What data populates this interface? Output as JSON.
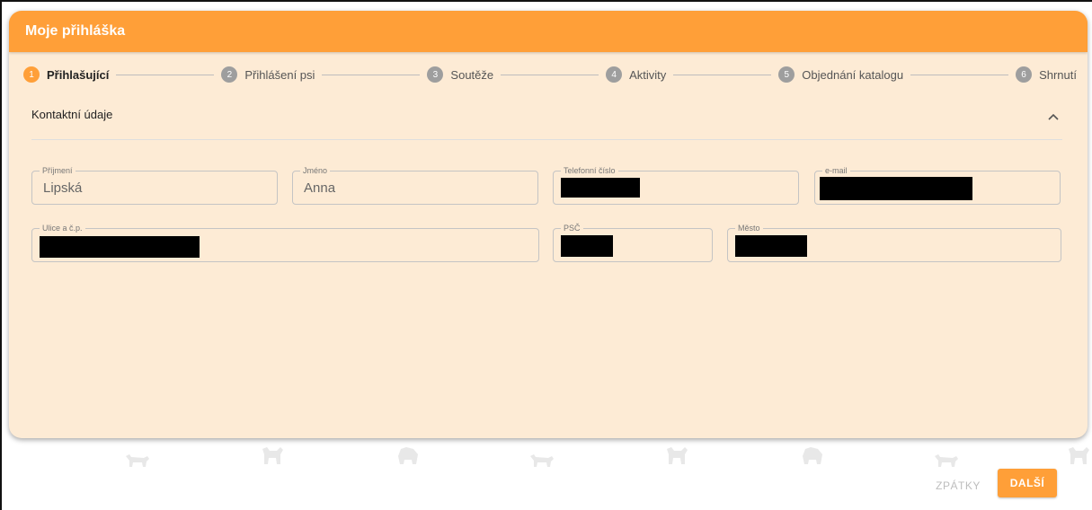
{
  "header": {
    "title": "Moje přihláška"
  },
  "stepper": {
    "steps": [
      {
        "num": "1",
        "label": "Přihlašující"
      },
      {
        "num": "2",
        "label": "Přihlášení psi"
      },
      {
        "num": "3",
        "label": "Soutěže"
      },
      {
        "num": "4",
        "label": "Aktivity"
      },
      {
        "num": "5",
        "label": "Objednání katalogu"
      },
      {
        "num": "6",
        "label": "Shrnutí"
      }
    ],
    "active_step": 1
  },
  "section": {
    "title": "Kontaktní údaje",
    "icon": "chevron-up-icon"
  },
  "fields": {
    "surname": {
      "label": "Příjmení",
      "value": "Lipská"
    },
    "first_name": {
      "label": "Jméno",
      "value": "Anna"
    },
    "phone": {
      "label": "Telefonní číslo",
      "value": ""
    },
    "email": {
      "label": "e-mail",
      "value": ""
    },
    "street": {
      "label": "Ulice a č.p.",
      "value": ""
    },
    "zip": {
      "label": "PSČ",
      "value": ""
    },
    "city": {
      "label": "Město",
      "value": ""
    }
  },
  "buttons": {
    "back": "ZPÁTKY",
    "next": "DALŠÍ"
  },
  "colors": {
    "accent": "#ff9f38",
    "card_bg": "#fdebd5"
  }
}
